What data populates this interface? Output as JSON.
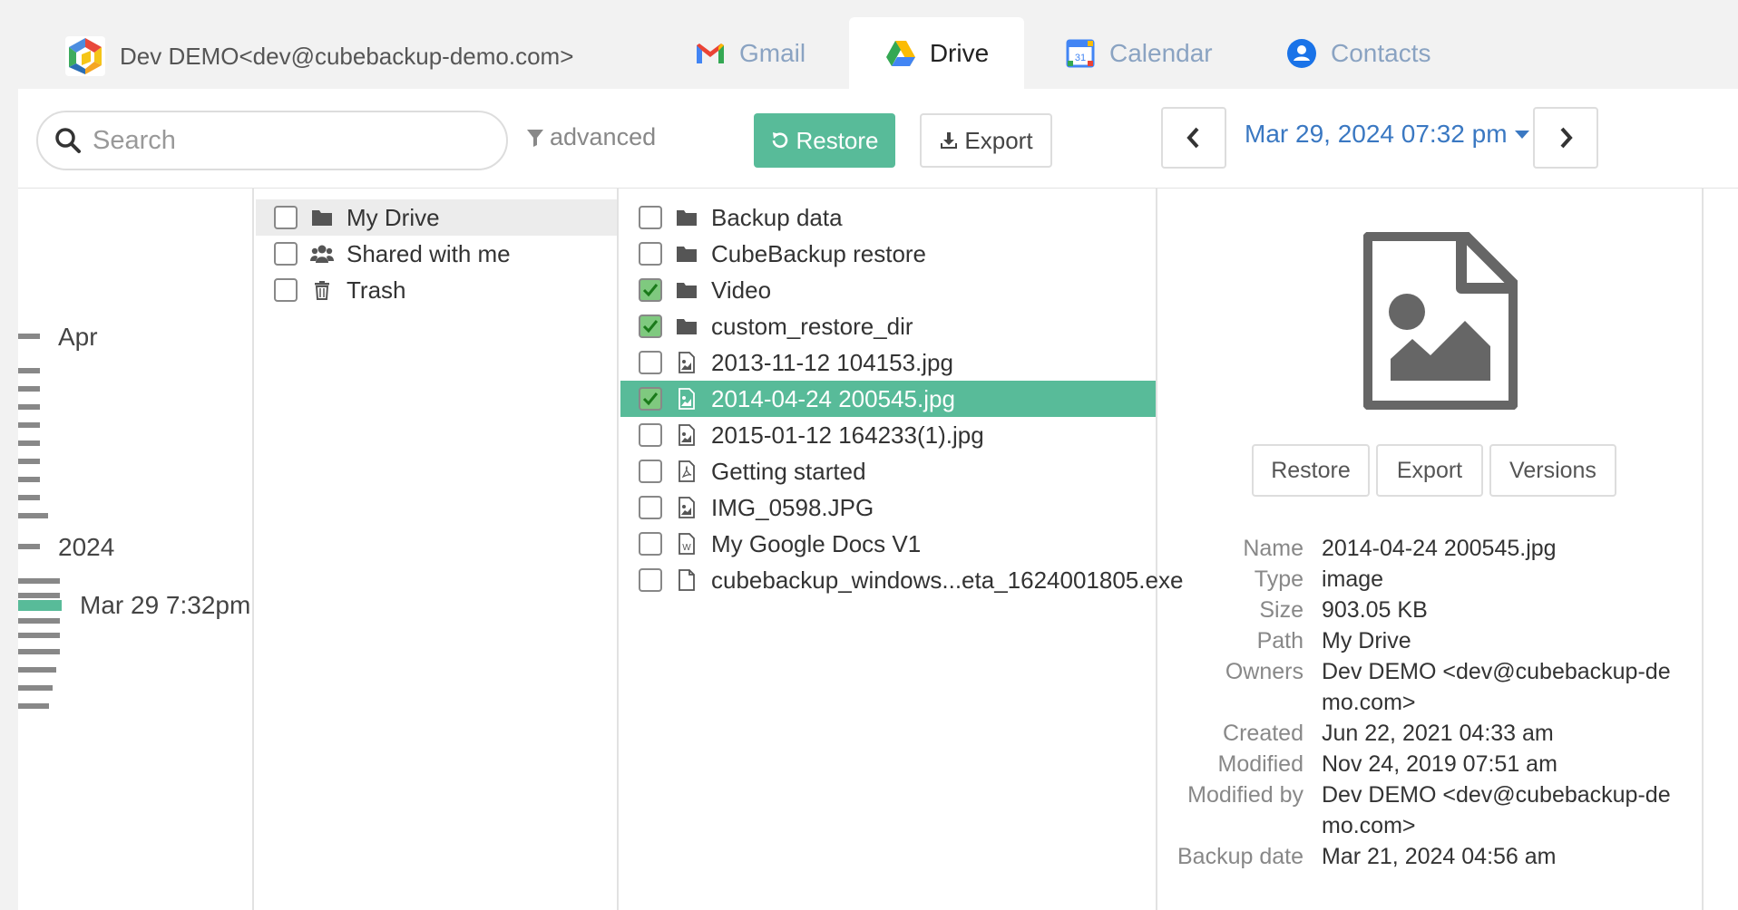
{
  "account": {
    "label": "Dev DEMO<dev@cubebackup-demo.com>"
  },
  "tabs": [
    {
      "label": "Gmail",
      "icon": "gmail-icon"
    },
    {
      "label": "Drive",
      "icon": "drive-icon",
      "active": true
    },
    {
      "label": "Calendar",
      "icon": "calendar-icon"
    },
    {
      "label": "Contacts",
      "icon": "contacts-icon"
    }
  ],
  "toolbar": {
    "search_placeholder": "Search",
    "advanced_label": "advanced",
    "restore_label": "Restore",
    "export_label": "Export",
    "date_label": "Mar 29, 2024 07:32 pm"
  },
  "timeline": {
    "labels": [
      "Apr",
      "2024",
      "Mar 29 7:32pm"
    ]
  },
  "tree": [
    {
      "label": "My Drive",
      "icon": "folder-icon",
      "checked": false
    },
    {
      "label": "Shared with me",
      "icon": "users-icon",
      "checked": false
    },
    {
      "label": "Trash",
      "icon": "trash-icon",
      "checked": false
    }
  ],
  "files": [
    {
      "label": "Backup data",
      "icon": "folder-icon",
      "checked": false
    },
    {
      "label": "CubeBackup restore",
      "icon": "folder-icon",
      "checked": false
    },
    {
      "label": "Video",
      "icon": "folder-icon",
      "checked": true
    },
    {
      "label": "custom_restore_dir",
      "icon": "folder-icon",
      "checked": true
    },
    {
      "label": "2013-11-12 104153.jpg",
      "icon": "image-file-icon",
      "checked": false
    },
    {
      "label": "2014-04-24 200545.jpg",
      "icon": "image-file-icon",
      "checked": true,
      "selected": true
    },
    {
      "label": "2015-01-12 164233(1).jpg",
      "icon": "image-file-icon",
      "checked": false
    },
    {
      "label": "Getting started",
      "icon": "pdf-file-icon",
      "checked": false
    },
    {
      "label": "IMG_0598.JPG",
      "icon": "image-file-icon",
      "checked": false
    },
    {
      "label": "My Google Docs V1",
      "icon": "word-file-icon",
      "checked": false
    },
    {
      "label": "cubebackup_windows...eta_1624001805.exe",
      "icon": "file-icon",
      "checked": false
    }
  ],
  "preview": {
    "restore_label": "Restore",
    "export_label": "Export",
    "versions_label": "Versions",
    "meta": [
      {
        "key": "Name",
        "value": "2014-04-24 200545.jpg"
      },
      {
        "key": "Type",
        "value": "image"
      },
      {
        "key": "Size",
        "value": "903.05 KB"
      },
      {
        "key": "Path",
        "value": "My Drive"
      },
      {
        "key": "Owners",
        "value": "Dev DEMO <dev@cubebackup-demo.com>"
      },
      {
        "key": "Created",
        "value": "Jun 22, 2021 04:33 am"
      },
      {
        "key": "Modified",
        "value": "Nov 24, 2019 07:51 am"
      },
      {
        "key": "Modified by",
        "value": "Dev DEMO <dev@cubebackup-demo.com>"
      },
      {
        "key": "Backup date",
        "value": "Mar 21, 2024 04:56 am"
      }
    ]
  },
  "colors": {
    "accent": "#58bb99",
    "link": "#3a78c2",
    "check": "#1a7a1a"
  }
}
